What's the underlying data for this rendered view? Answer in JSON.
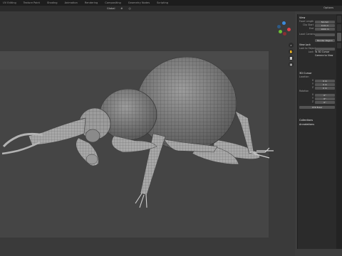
{
  "workspace_tabs": [
    "UV Editing",
    "Texture Paint",
    "Shading",
    "Animation",
    "Rendering",
    "Compositing",
    "Geometry Nodes",
    "Scripting"
  ],
  "header": {
    "orientation_label": "Global",
    "view_label": "Options"
  },
  "npanel": {
    "tabs": [
      "Item",
      "Tool",
      "View",
      "Wkspc"
    ],
    "view_section": {
      "title": "View",
      "focal_length_label": "Focal Length",
      "focal_length_value": "50 mm",
      "clip_start_label": "Clip Start",
      "clip_start_value": "0.01 m",
      "clip_end_label": "End",
      "clip_end_value": "1000 m",
      "local_camera_label": "Local Camera",
      "render_region_label": "Render Region",
      "view_lock_label": "View Lock",
      "lock_to_object_label": "Lock to Object",
      "lock_label": "Lock",
      "to_3d_cursor_label": "To 3D Cursor",
      "camera_to_view_label": "Camera to View"
    },
    "cursor_section": {
      "title": "3D Cursor",
      "location_label": "Location",
      "x_label": "X",
      "x_value": "0 m",
      "y_label": "Y",
      "y_value": "0 m",
      "z_label": "Z",
      "z_value": "0 m",
      "rotation_label": "Rotation",
      "rx_value": "0°",
      "ry_value": "0°",
      "rz_value": "0°",
      "mode_value": "XYZ Euler"
    },
    "collections_label": "Collections",
    "annotations_label": "Annotations"
  },
  "colors": {
    "gizmo_x": "#e0404a",
    "gizmo_y": "#6cbf35",
    "gizmo_z": "#3b8bdc"
  }
}
